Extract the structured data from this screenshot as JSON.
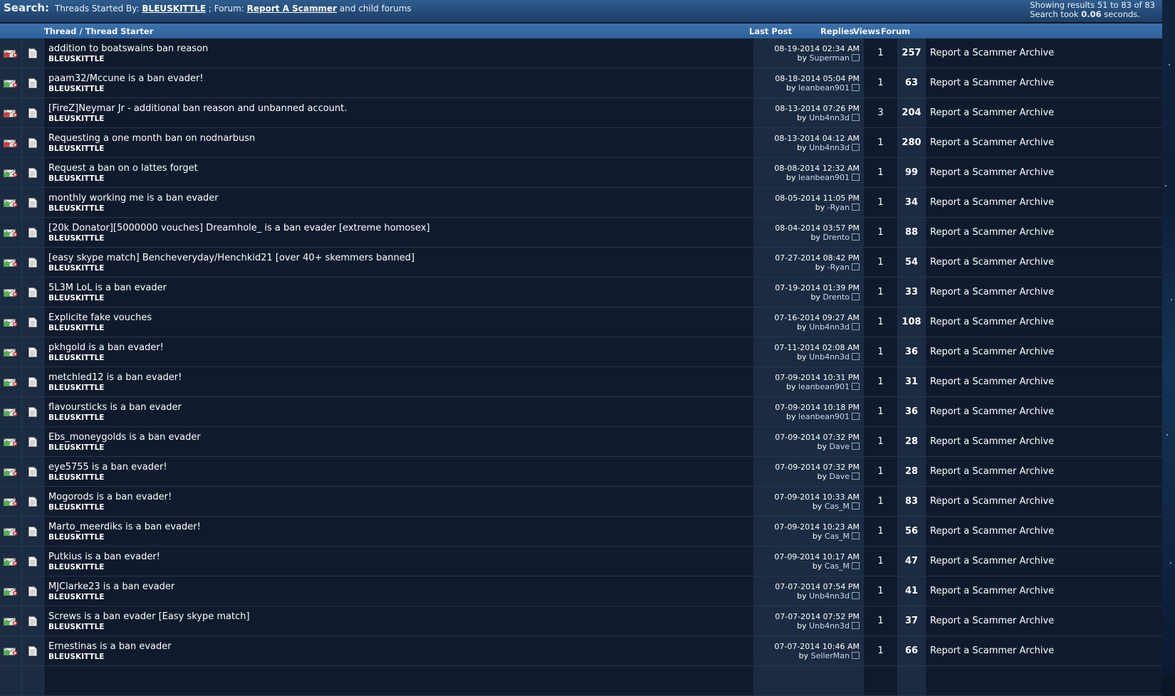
{
  "search": {
    "label": "Search:",
    "prefix": "Threads Started By:",
    "user": "BLEUSKITTLE",
    "mid": "; Forum:",
    "forum": "Report A Scammer",
    "suffix": "and child forums",
    "results_line": "Showing results 51 to 83 of 83",
    "took_prefix": "Search took",
    "took_value": "0.06",
    "took_suffix": "seconds."
  },
  "columns": {
    "thread": "Thread / Thread Starter",
    "last_post": "Last Post",
    "replies": "Replies",
    "views": "Views",
    "forum": "Forum"
  },
  "colors": {
    "header_bar": "#2f5d8e",
    "column_bar": "#3c72ab",
    "row_dark": "#0f1b2d",
    "row_mid": "#1b2c42",
    "envelope_hot": "#d03b3b",
    "envelope_new": "#4bb34b"
  },
  "rows": [
    {
      "title": "addition to boatswains ban reason",
      "starter": "BLEUSKITTLE",
      "date": "08-19-2014 02:34 AM",
      "by": "by",
      "user": "Superman",
      "replies": "1",
      "views": "257",
      "forum": "Report a Scammer Archive",
      "hot": true
    },
    {
      "title": "paam32/Mccune is a ban evader!",
      "starter": "BLEUSKITTLE",
      "date": "08-18-2014 05:04 PM",
      "by": "by",
      "user": "leanbean901",
      "replies": "1",
      "views": "63",
      "forum": "Report a Scammer Archive",
      "hot": false
    },
    {
      "title": "[FireZ]Neymar Jr - additional ban reason and unbanned account.",
      "starter": "BLEUSKITTLE",
      "date": "08-13-2014 07:26 PM",
      "by": "by",
      "user": "Unb4nn3d",
      "replies": "3",
      "views": "204",
      "forum": "Report a Scammer Archive",
      "hot": true
    },
    {
      "title": "Requesting a one month ban on nodnarbusn",
      "starter": "BLEUSKITTLE",
      "date": "08-13-2014 04:12 AM",
      "by": "by",
      "user": "Unb4nn3d",
      "replies": "1",
      "views": "280",
      "forum": "Report a Scammer Archive",
      "hot": true
    },
    {
      "title": "Request a ban on o lattes forget",
      "starter": "BLEUSKITTLE",
      "date": "08-08-2014 12:32 AM",
      "by": "by",
      "user": "leanbean901",
      "replies": "1",
      "views": "99",
      "forum": "Report a Scammer Archive",
      "hot": false
    },
    {
      "title": "monthly working me is a ban evader",
      "starter": "BLEUSKITTLE",
      "date": "08-05-2014 11:05 PM",
      "by": "by",
      "user": "-Ryan",
      "replies": "1",
      "views": "34",
      "forum": "Report a Scammer Archive",
      "hot": false
    },
    {
      "title": "[20k Donator][5000000 vouches] Dreamhole_ is a ban evader [extreme homosex]",
      "starter": "BLEUSKITTLE",
      "date": "08-04-2014 03:57 PM",
      "by": "by",
      "user": "Drento",
      "replies": "1",
      "views": "88",
      "forum": "Report a Scammer Archive",
      "hot": false
    },
    {
      "title": "[easy skype match] Bencheveryday/Henchkid21 [over 40+ skemmers banned]",
      "starter": "BLEUSKITTLE",
      "date": "07-27-2014 08:42 PM",
      "by": "by",
      "user": "-Ryan",
      "replies": "1",
      "views": "54",
      "forum": "Report a Scammer Archive",
      "hot": false
    },
    {
      "title": "5L3M LoL is a ban evader",
      "starter": "BLEUSKITTLE",
      "date": "07-19-2014 01:39 PM",
      "by": "by",
      "user": "Drento",
      "replies": "1",
      "views": "33",
      "forum": "Report a Scammer Archive",
      "hot": false
    },
    {
      "title": "Explicite fake vouches",
      "starter": "BLEUSKITTLE",
      "date": "07-16-2014 09:27 AM",
      "by": "by",
      "user": "Unb4nn3d",
      "replies": "1",
      "views": "108",
      "forum": "Report a Scammer Archive",
      "hot": false
    },
    {
      "title": "pkhgold is a ban evader!",
      "starter": "BLEUSKITTLE",
      "date": "07-11-2014 02:08 AM",
      "by": "by",
      "user": "Unb4nn3d",
      "replies": "1",
      "views": "36",
      "forum": "Report a Scammer Archive",
      "hot": false
    },
    {
      "title": "metchled12 is a ban evader!",
      "starter": "BLEUSKITTLE",
      "date": "07-09-2014 10:31 PM",
      "by": "by",
      "user": "leanbean901",
      "replies": "1",
      "views": "31",
      "forum": "Report a Scammer Archive",
      "hot": false
    },
    {
      "title": "flavoursticks is a ban evader",
      "starter": "BLEUSKITTLE",
      "date": "07-09-2014 10:18 PM",
      "by": "by",
      "user": "leanbean901",
      "replies": "1",
      "views": "36",
      "forum": "Report a Scammer Archive",
      "hot": false
    },
    {
      "title": "Ebs_moneygolds is a ban evader",
      "starter": "BLEUSKITTLE",
      "date": "07-09-2014 07:32 PM",
      "by": "by",
      "user": "Dave",
      "replies": "1",
      "views": "28",
      "forum": "Report a Scammer Archive",
      "hot": false
    },
    {
      "title": "eye5755 is a ban evader!",
      "starter": "BLEUSKITTLE",
      "date": "07-09-2014 07:32 PM",
      "by": "by",
      "user": "Dave",
      "replies": "1",
      "views": "28",
      "forum": "Report a Scammer Archive",
      "hot": false
    },
    {
      "title": "Mogorods is a ban evader!",
      "starter": "BLEUSKITTLE",
      "date": "07-09-2014 10:33 AM",
      "by": "by",
      "user": "Cas_M",
      "replies": "1",
      "views": "83",
      "forum": "Report a Scammer Archive",
      "hot": false
    },
    {
      "title": "Marto_meerdiks is a ban evader!",
      "starter": "BLEUSKITTLE",
      "date": "07-09-2014 10:23 AM",
      "by": "by",
      "user": "Cas_M",
      "replies": "1",
      "views": "56",
      "forum": "Report a Scammer Archive",
      "hot": false
    },
    {
      "title": "Putkius is a ban evader!",
      "starter": "BLEUSKITTLE",
      "date": "07-09-2014 10:17 AM",
      "by": "by",
      "user": "Cas_M",
      "replies": "1",
      "views": "47",
      "forum": "Report a Scammer Archive",
      "hot": false
    },
    {
      "title": "MJClarke23 is a ban evader",
      "starter": "BLEUSKITTLE",
      "date": "07-07-2014 07:54 PM",
      "by": "by",
      "user": "Unb4nn3d",
      "replies": "1",
      "views": "41",
      "forum": "Report a Scammer Archive",
      "hot": false
    },
    {
      "title": "Screws is a ban evader [Easy skype match]",
      "starter": "BLEUSKITTLE",
      "date": "07-07-2014 07:52 PM",
      "by": "by",
      "user": "Unb4nn3d",
      "replies": "1",
      "views": "37",
      "forum": "Report a Scammer Archive",
      "hot": false
    },
    {
      "title": "Ernestinas is a ban evader",
      "starter": "BLEUSKITTLE",
      "date": "07-07-2014 10:46 AM",
      "by": "by",
      "user": "SellerMan",
      "replies": "1",
      "views": "66",
      "forum": "Report a Scammer Archive",
      "hot": false
    }
  ]
}
